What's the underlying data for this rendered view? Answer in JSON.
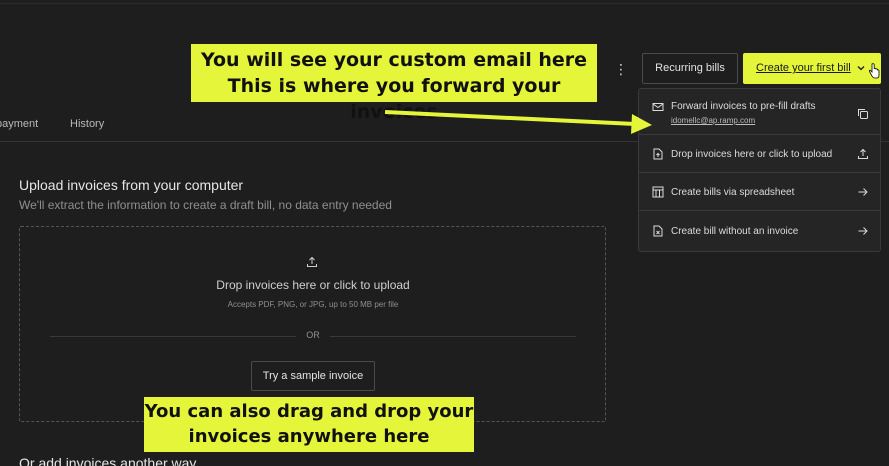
{
  "tabs": {
    "payment": "payment",
    "history": "History"
  },
  "header": {
    "more_icon": "kebab-vertical-icon",
    "recurring_label": "Recurring bills",
    "create_label": "Create your first bill"
  },
  "upload": {
    "title": "Upload invoices from your computer",
    "subtitle": "We'll extract the information to create a draft bill, no data entry needed",
    "drop_title": "Drop invoices here or click to upload",
    "drop_sub": "Accepts PDF, PNG, or JPG, up to 50 MB per file",
    "or_text": "OR",
    "sample_button": "Try a sample invoice",
    "more_ways": "Or add invoices another way"
  },
  "menu": {
    "items": [
      {
        "label": "Forward invoices to pre-fill drafts",
        "email": "idomellc@ap.ramp.com",
        "icon": "mail-icon",
        "action_icon": "copy-icon"
      },
      {
        "label": "Drop invoices here or click to upload",
        "icon": "file-upload-icon",
        "action_icon": "upload-icon"
      },
      {
        "label": "Create bills via spreadsheet",
        "icon": "spreadsheet-icon",
        "action_icon": "arrow-right-icon"
      },
      {
        "label": "Create bill without an invoice",
        "icon": "file-x-icon",
        "action_icon": "arrow-right-icon"
      }
    ]
  },
  "annotations": {
    "top_line1": "You will see your custom email here",
    "top_line2": "This is where you forward your invoices",
    "bottom_line1": "You can also drag and drop your",
    "bottom_line2": "invoices anywhere here"
  },
  "colors": {
    "background": "#1e1e1e",
    "accent": "#e4f53a",
    "border": "#3a3a3a"
  }
}
